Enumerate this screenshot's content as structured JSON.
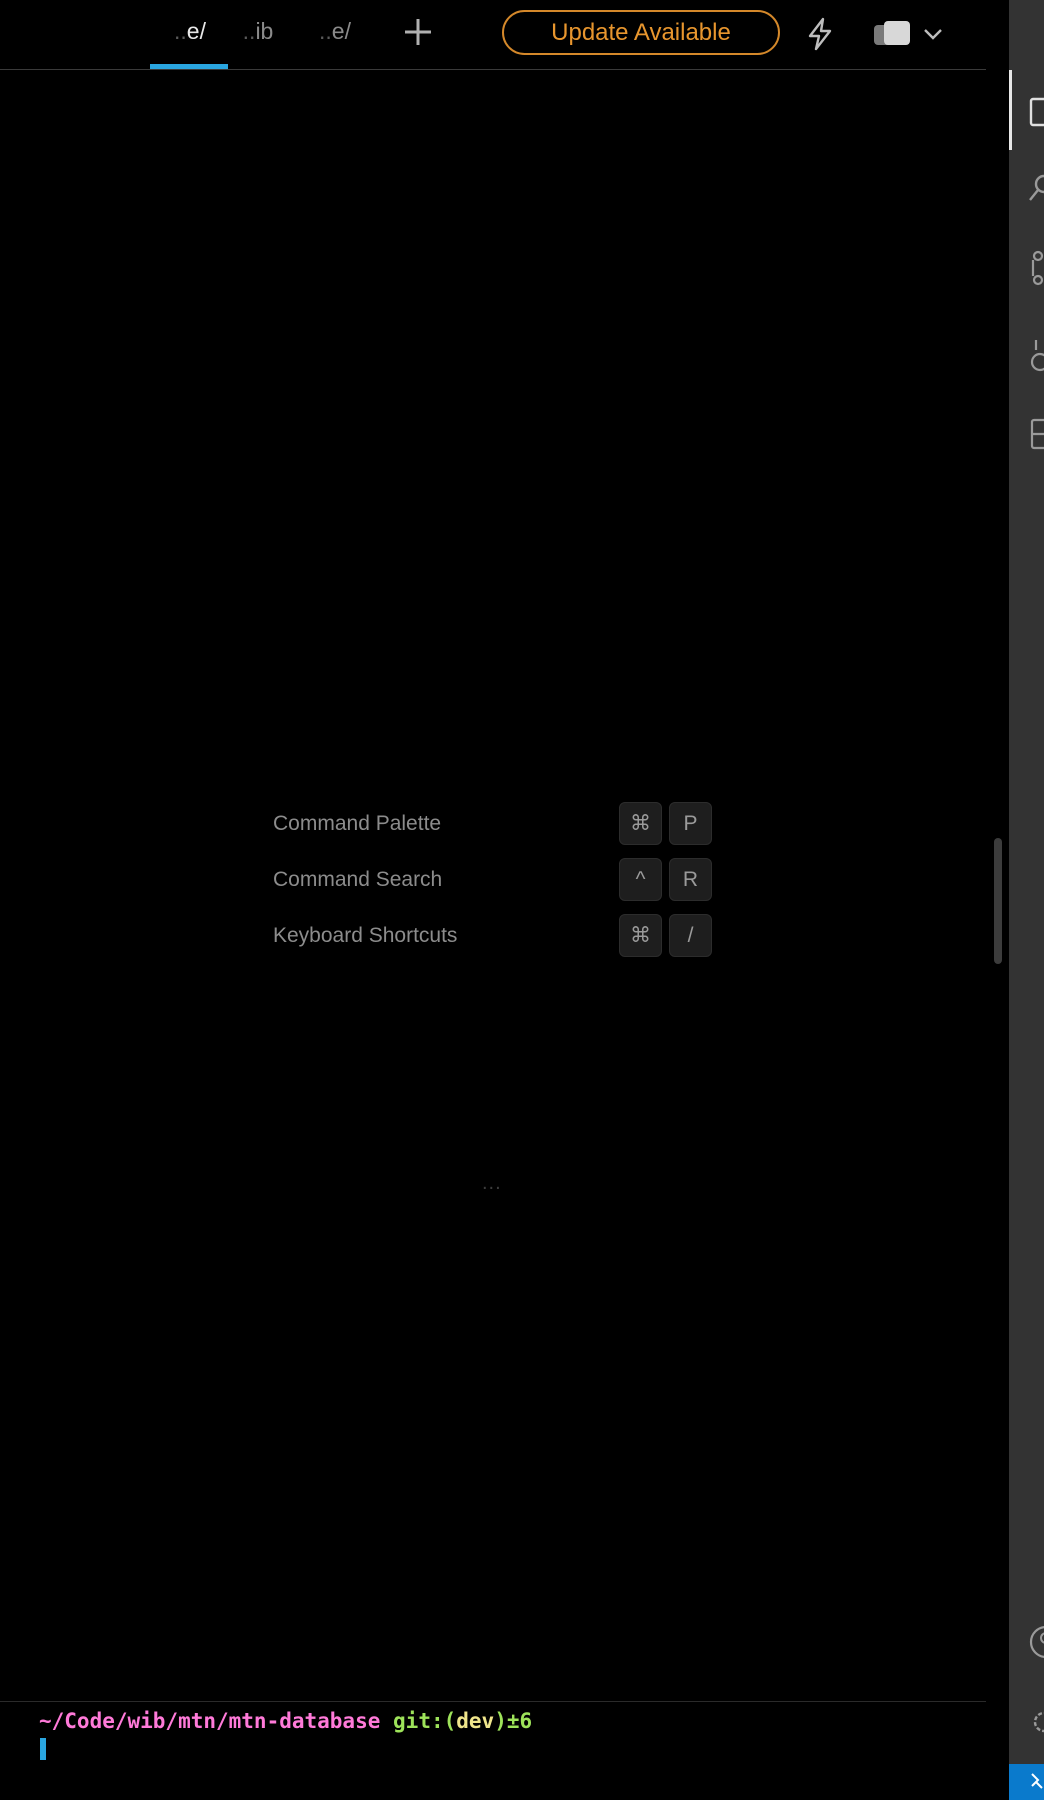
{
  "tabs": [
    {
      "prefix": "..",
      "label": "e/",
      "active": true
    },
    {
      "prefix": "..",
      "label": "ib",
      "active": false
    },
    {
      "prefix": "..",
      "label": "e/",
      "active": false
    }
  ],
  "update_button": {
    "label": "Update Available"
  },
  "colors": {
    "accent": "#2aa6e0",
    "update_orange": "#e8962e",
    "prompt_path": "#ff7ad9",
    "prompt_git": "#9ee35a",
    "prompt_branch": "#f0e68c",
    "activity_bar": "#333333",
    "status_bar": "#0a7acc"
  },
  "icons": {
    "add_tab": "plus-icon",
    "warp_ai": "lightning-bolt-icon",
    "theme": "theme-toggle-icon",
    "theme_menu": "chevron-down-icon"
  },
  "shortcuts": [
    {
      "label": "Command Palette",
      "keys": [
        "⌘",
        "P"
      ]
    },
    {
      "label": "Command Search",
      "keys": [
        "^",
        "R"
      ]
    },
    {
      "label": "Keyboard Shortcuts",
      "keys": [
        "⌘",
        "/"
      ]
    }
  ],
  "ellipsis": "...",
  "prompt": {
    "path": "~/Code/wib/mtn/mtn-database",
    "git_prefix": "git:(",
    "branch": "dev",
    "git_suffix": ")",
    "status": "±6"
  },
  "activity_bar": {
    "items": [
      "explorer-icon",
      "search-icon",
      "source-control-icon",
      "run-debug-icon",
      "extensions-icon",
      "account-icon",
      "manage-gear-icon"
    ]
  }
}
